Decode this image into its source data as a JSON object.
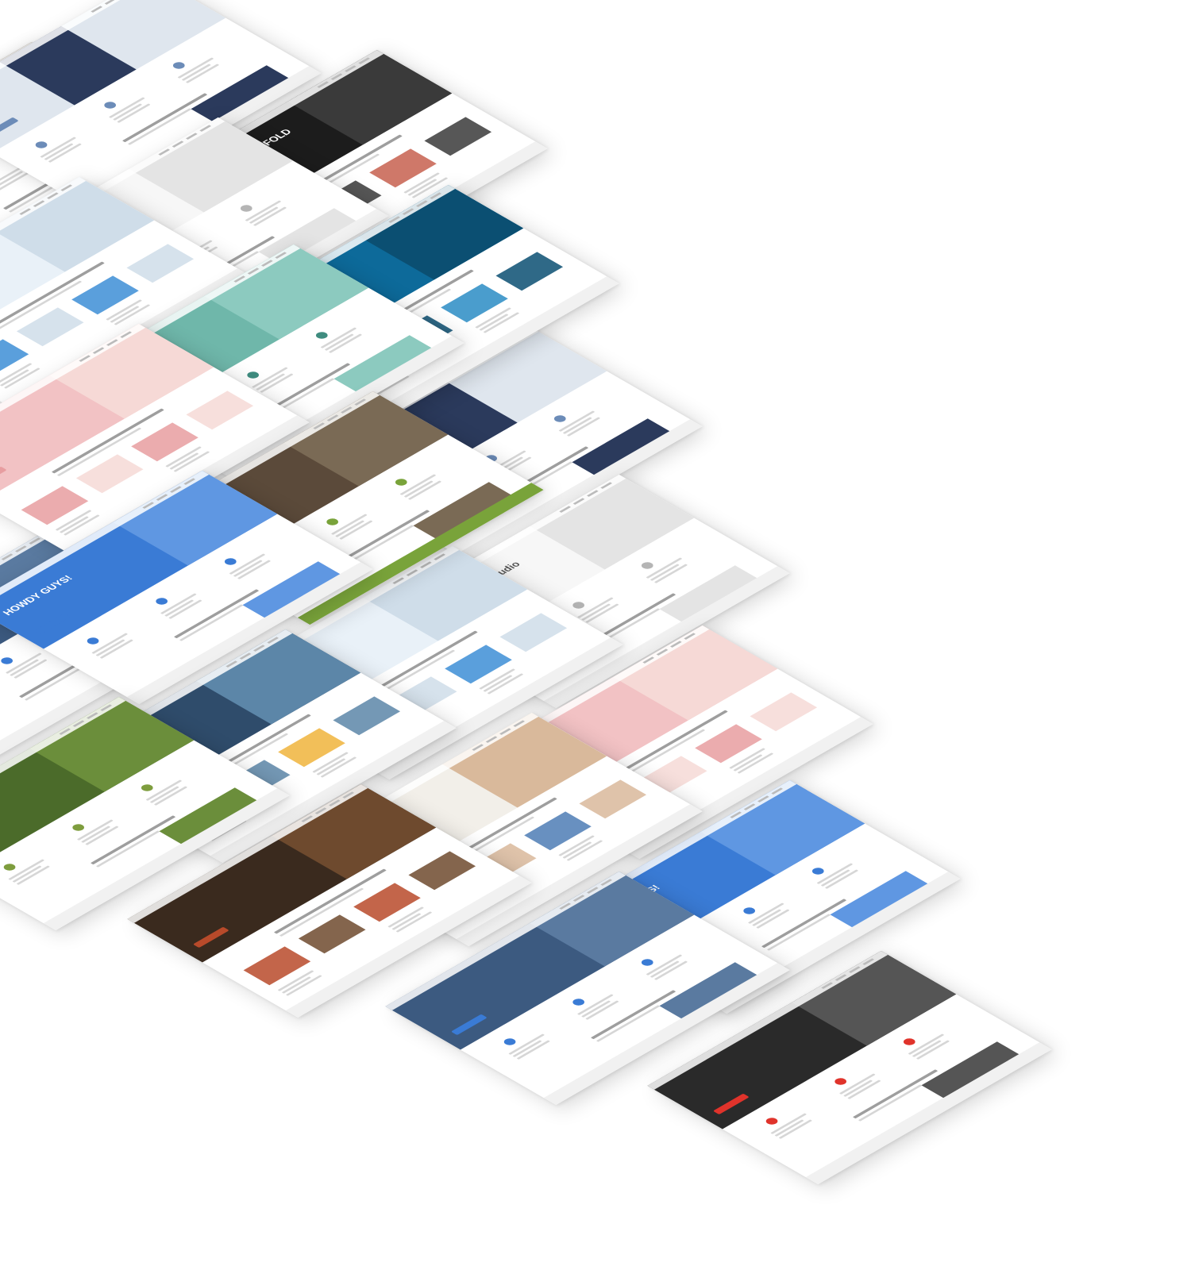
{
  "cards": [
    {
      "name": "business-consultant",
      "hero": "#dfe6ee",
      "accent": "#6c8cb8",
      "photo": "#2b3a5c",
      "title": "",
      "titleColor": "#333333",
      "layout": "portrait"
    },
    {
      "name": "portfolio-dark",
      "hero": "#1c1c1c",
      "accent": "#c7604f",
      "photo": "#3a3a3a",
      "title": "WELCOME. I AM ENFOLD",
      "titleColor": "#ffffff",
      "layout": "grid"
    },
    {
      "name": "creative-studio",
      "hero": "#f7f7f7",
      "accent": "#b5b5b5",
      "photo": "#e4e4e4",
      "title": "Enfold Creative Studio",
      "titleColor": "#555555",
      "layout": "minimal"
    },
    {
      "name": "diving-travel",
      "hero": "#0d6a9a",
      "accent": "#2a8cc4",
      "photo": "#0b4f72",
      "title": "",
      "titleColor": "#ffffff",
      "layout": "gallery"
    },
    {
      "name": "medical",
      "hero": "#e9f1f8",
      "accent": "#3d8ed6",
      "photo": "#cfdde9",
      "title": "",
      "titleColor": "#ffffff",
      "layout": "blue-tiles"
    },
    {
      "name": "teal-agency",
      "hero": "#6fb7aa",
      "accent": "#3f8c7f",
      "photo": "#8ccabf",
      "title": "",
      "titleColor": "#ffffff",
      "layout": "devices"
    },
    {
      "name": "spa-pink",
      "hero": "#f2c2c4",
      "accent": "#e79da0",
      "photo": "#f6d9d6",
      "title": "",
      "titleColor": "#6a4a4a",
      "layout": "tiles-pink"
    },
    {
      "name": "church-green",
      "hero": "#5b4a3a",
      "accent": "#79a33a",
      "photo": "#7a6a55",
      "title": "",
      "titleColor": "#ffffff",
      "layout": "green"
    },
    {
      "name": "howdy-app",
      "hero": "#3a7bd5",
      "accent": "#3a7bd5",
      "photo": "#5f97e2",
      "title": "HOWDY GUYS!",
      "titleColor": "#ffffff",
      "layout": "app"
    },
    {
      "name": "hotel-resort",
      "hero": "#2f4c6b",
      "accent": "#f0b43c",
      "photo": "#5c86a8",
      "title": "",
      "titleColor": "#ffffff",
      "layout": "hotel"
    },
    {
      "name": "nature-yoga",
      "hero": "#4b6b2a",
      "accent": "#7e9d3e",
      "photo": "#6b8e3b",
      "title": "",
      "titleColor": "#ffffff",
      "layout": "nature"
    },
    {
      "name": "fashion-shop",
      "hero": "#f2efe9",
      "accent": "#4d7cb5",
      "photo": "#d9b99b",
      "title": "",
      "titleColor": "#333333",
      "layout": "shop"
    },
    {
      "name": "restaurant",
      "hero": "#3a2a1e",
      "accent": "#b84a2a",
      "photo": "#6e4a2e",
      "title": "",
      "titleColor": "#ffffff",
      "layout": "food"
    },
    {
      "name": "tech-dark-blue",
      "hero": "#3c5a80",
      "accent": "#3a7bd5",
      "photo": "#5a7aa0",
      "title": "",
      "titleColor": "#ffffff",
      "layout": "tech"
    },
    {
      "name": "gym",
      "hero": "#2a2a2a",
      "accent": "#e0332b",
      "photo": "#555555",
      "title": "",
      "titleColor": "#ffffff",
      "layout": "gym"
    }
  ]
}
